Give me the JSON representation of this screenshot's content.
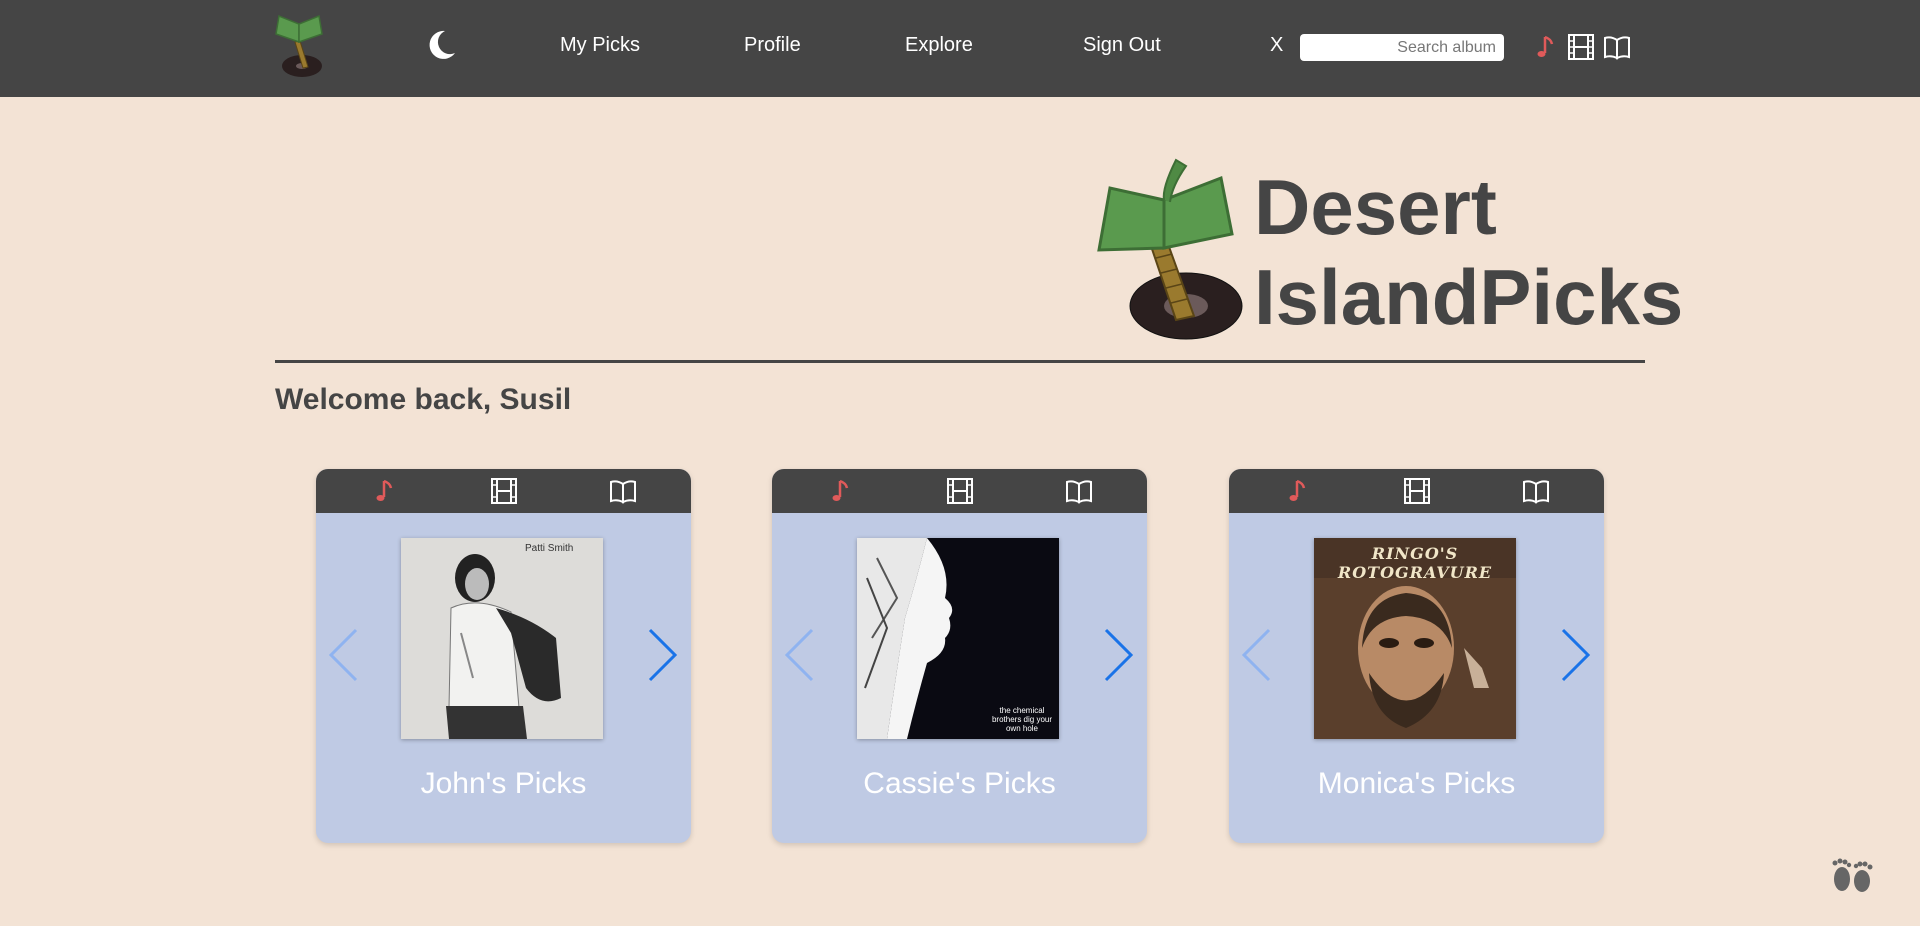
{
  "nav": {
    "links": [
      "My Picks",
      "Profile",
      "Explore",
      "Sign Out"
    ],
    "clear_label": "X",
    "search_placeholder": "Search album",
    "active_category": "music",
    "colors": {
      "bar": "#454545",
      "accent": "#e05a5a"
    }
  },
  "brand": {
    "title_line1": "Desert",
    "title_line2": "IslandPicks"
  },
  "welcome": "Welcome back, Susil",
  "cards": [
    {
      "label": "John's Picks",
      "cover_text": "Patti Smith"
    },
    {
      "label": "Cassie's Picks",
      "cover_text": "the chemical brothers dig your own hole"
    },
    {
      "label": "Monica's Picks",
      "cover_text": "RINGO'S ROTOGRAVURE"
    }
  ],
  "icons": [
    "moon-icon",
    "music-note-icon",
    "film-icon",
    "book-icon",
    "chevron-left-icon",
    "chevron-right-icon",
    "footprints-icon"
  ]
}
